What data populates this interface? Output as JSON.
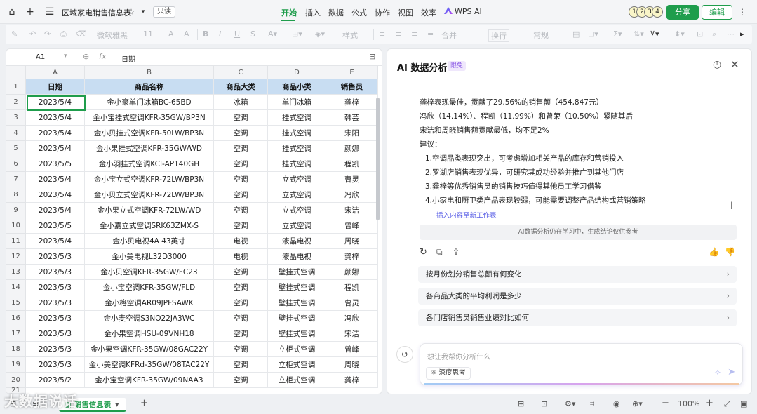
{
  "titlebar": {
    "doc_title": "区域家电销售信息表",
    "readonly": "只读",
    "menus": [
      "开始",
      "插入",
      "数据",
      "公式",
      "协作",
      "视图",
      "效率"
    ],
    "ai_menu": "WPS AI",
    "avatars": [
      "1",
      "2",
      "3",
      "4"
    ],
    "share": "分享",
    "edit": "编辑"
  },
  "toolbar": {
    "font": "微软雅黑",
    "size": "11",
    "style": "样式",
    "merge": "合并",
    "wrap": "换行",
    "format": "常规"
  },
  "formula": {
    "cell_ref": "A1",
    "value": "日期"
  },
  "sheet": {
    "col_headers": [
      "A",
      "B",
      "C",
      "D",
      "E"
    ],
    "headers": [
      "日期",
      "商品名称",
      "商品大类",
      "商品小类",
      "销售员"
    ],
    "rows": [
      [
        "2023/5/4",
        "金小豪单门冰箱BC-65BD",
        "冰箱",
        "单门冰箱",
        "龚梓"
      ],
      [
        "2023/5/4",
        "金小宝挂式空调KFR-35GW/BP3N",
        "空调",
        "挂式空调",
        "韩芸"
      ],
      [
        "2023/5/4",
        "金小贝挂式空调KFR-50LW/BP3N",
        "空调",
        "挂式空调",
        "宋阳"
      ],
      [
        "2023/5/4",
        "金小果挂式空调KFR-35GW/WD",
        "空调",
        "挂式空调",
        "颜娜"
      ],
      [
        "2023/5/5",
        "金小羽挂式空调KCI-AP140GH",
        "空调",
        "挂式空调",
        "程凯"
      ],
      [
        "2023/5/4",
        "金小宝立式空调KFR-72LW/BP3N",
        "空调",
        "立式空调",
        "曹灵"
      ],
      [
        "2023/5/4",
        "金小贝立式空调KFR-72LW/BP3N",
        "空调",
        "立式空调",
        "冯欣"
      ],
      [
        "2023/5/4",
        "金小果立式空调KFR-72LW/WD",
        "空调",
        "立式空调",
        "宋洁"
      ],
      [
        "2023/5/5",
        "金小嘉立式空调SRK63ZMX-S",
        "空调",
        "立式空调",
        "曾峰"
      ],
      [
        "2023/5/4",
        "金小贝电视4A 43英寸",
        "电视",
        "液晶电视",
        "周晓"
      ],
      [
        "2023/5/3",
        "金小美电视L32D3000",
        "电视",
        "液晶电视",
        "龚梓"
      ],
      [
        "2023/5/3",
        "金小贝空调KFR-35GW/FC23",
        "空调",
        "壁挂式空调",
        "颜娜"
      ],
      [
        "2023/5/3",
        "金小宝空调KFR-35GW/FLD",
        "空调",
        "壁挂式空调",
        "程凯"
      ],
      [
        "2023/5/3",
        "金小格空调AR09JPFSAWK",
        "空调",
        "壁挂式空调",
        "曹灵"
      ],
      [
        "2023/5/3",
        "金小麦空调S3NO22JA3WC",
        "空调",
        "壁挂式空调",
        "冯欣"
      ],
      [
        "2023/5/3",
        "金小果空调HSU-09VNH18",
        "空调",
        "壁挂式空调",
        "宋洁"
      ],
      [
        "2023/5/3",
        "金小果空调KFR-35GW/08GAC22Y",
        "空调",
        "立柜式空调",
        "曾峰"
      ],
      [
        "2023/5/3",
        "金小美空调KFRd-35GW/08TAC22Y",
        "空调",
        "立柜式空调",
        "周晓"
      ],
      [
        "2023/5/2",
        "金小宝空调KFR-35GW/09NAA3",
        "空调",
        "立柜式空调",
        "龚梓"
      ]
    ]
  },
  "ai": {
    "title": "AI 数据分析",
    "badge": "限免",
    "lines": [
      "龚梓表现最佳，贡献了29.56%的销售额（454,847元）",
      "冯欣（14.14%）、程凯（11.99%）和曾荣（10.50%）紧随其后",
      "宋洁和周晓销售额贡献最低，均不足2%",
      "建议：",
      "1.空调品类表现突出，可考虑增加相关产品的库存和营销投入",
      "2.罗湖店销售表现优异，可研究其成功经验并推广到其他门店",
      "3.龚梓等优秀销售员的销售技巧值得其他员工学习借鉴",
      "4.小家电和厨卫类产品表现较弱，可能需要调整产品结构或营销策略"
    ],
    "insert_link": "插入内容至新工作表",
    "disclaimer": "AI数据分析仍在学习中，生成结论仅供参考",
    "suggestions": [
      "按月份划分销售总额有何变化",
      "各商品大类的平均利润是多少",
      "各门店销售员销售业绩对比如何"
    ],
    "input_placeholder": "想让我帮你分析什么",
    "deep_think": "深度思考"
  },
  "statusbar": {
    "sheet_tab": "销售信息表",
    "zoom": "100%"
  },
  "watermark": "大数据说话",
  "colors": {
    "accent": "#1f9d4c",
    "header_fill": "#c8ddf2",
    "ai_purple": "#8c5ce6"
  }
}
